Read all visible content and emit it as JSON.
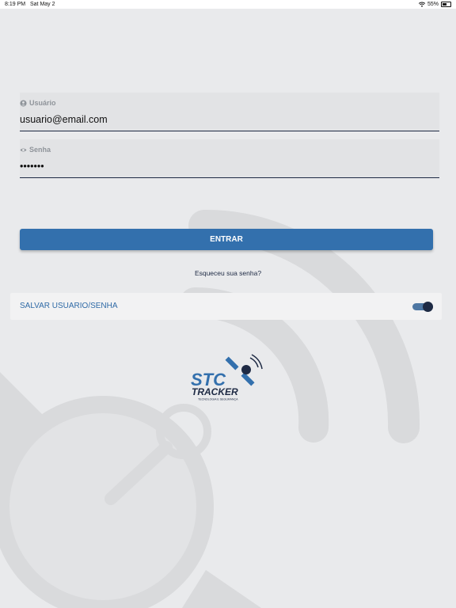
{
  "status_bar": {
    "time": "8:19 PM",
    "date": "Sat May 2",
    "battery": "55%"
  },
  "login": {
    "username_label": "Usuário",
    "username_value": "usuario@email.com",
    "password_label": "Senha",
    "password_value": "•••••••",
    "submit_label": "ENTRAR",
    "forgot_label": "Esqueceu sua senha?",
    "save_label": "SALVAR USUARIO/SENHA",
    "save_enabled": true
  },
  "logo": {
    "line1": "STC",
    "line2": "TRACKER",
    "tagline": "TECNOLOGIA E SEGURANÇA"
  },
  "colors": {
    "primary": "#3370ad",
    "dark": "#1e2a44",
    "background": "#e9eaec"
  },
  "icons": {
    "username": "user-circle-icon",
    "password": "eye-icon",
    "wifi": "wifi-icon",
    "battery": "battery-icon"
  }
}
